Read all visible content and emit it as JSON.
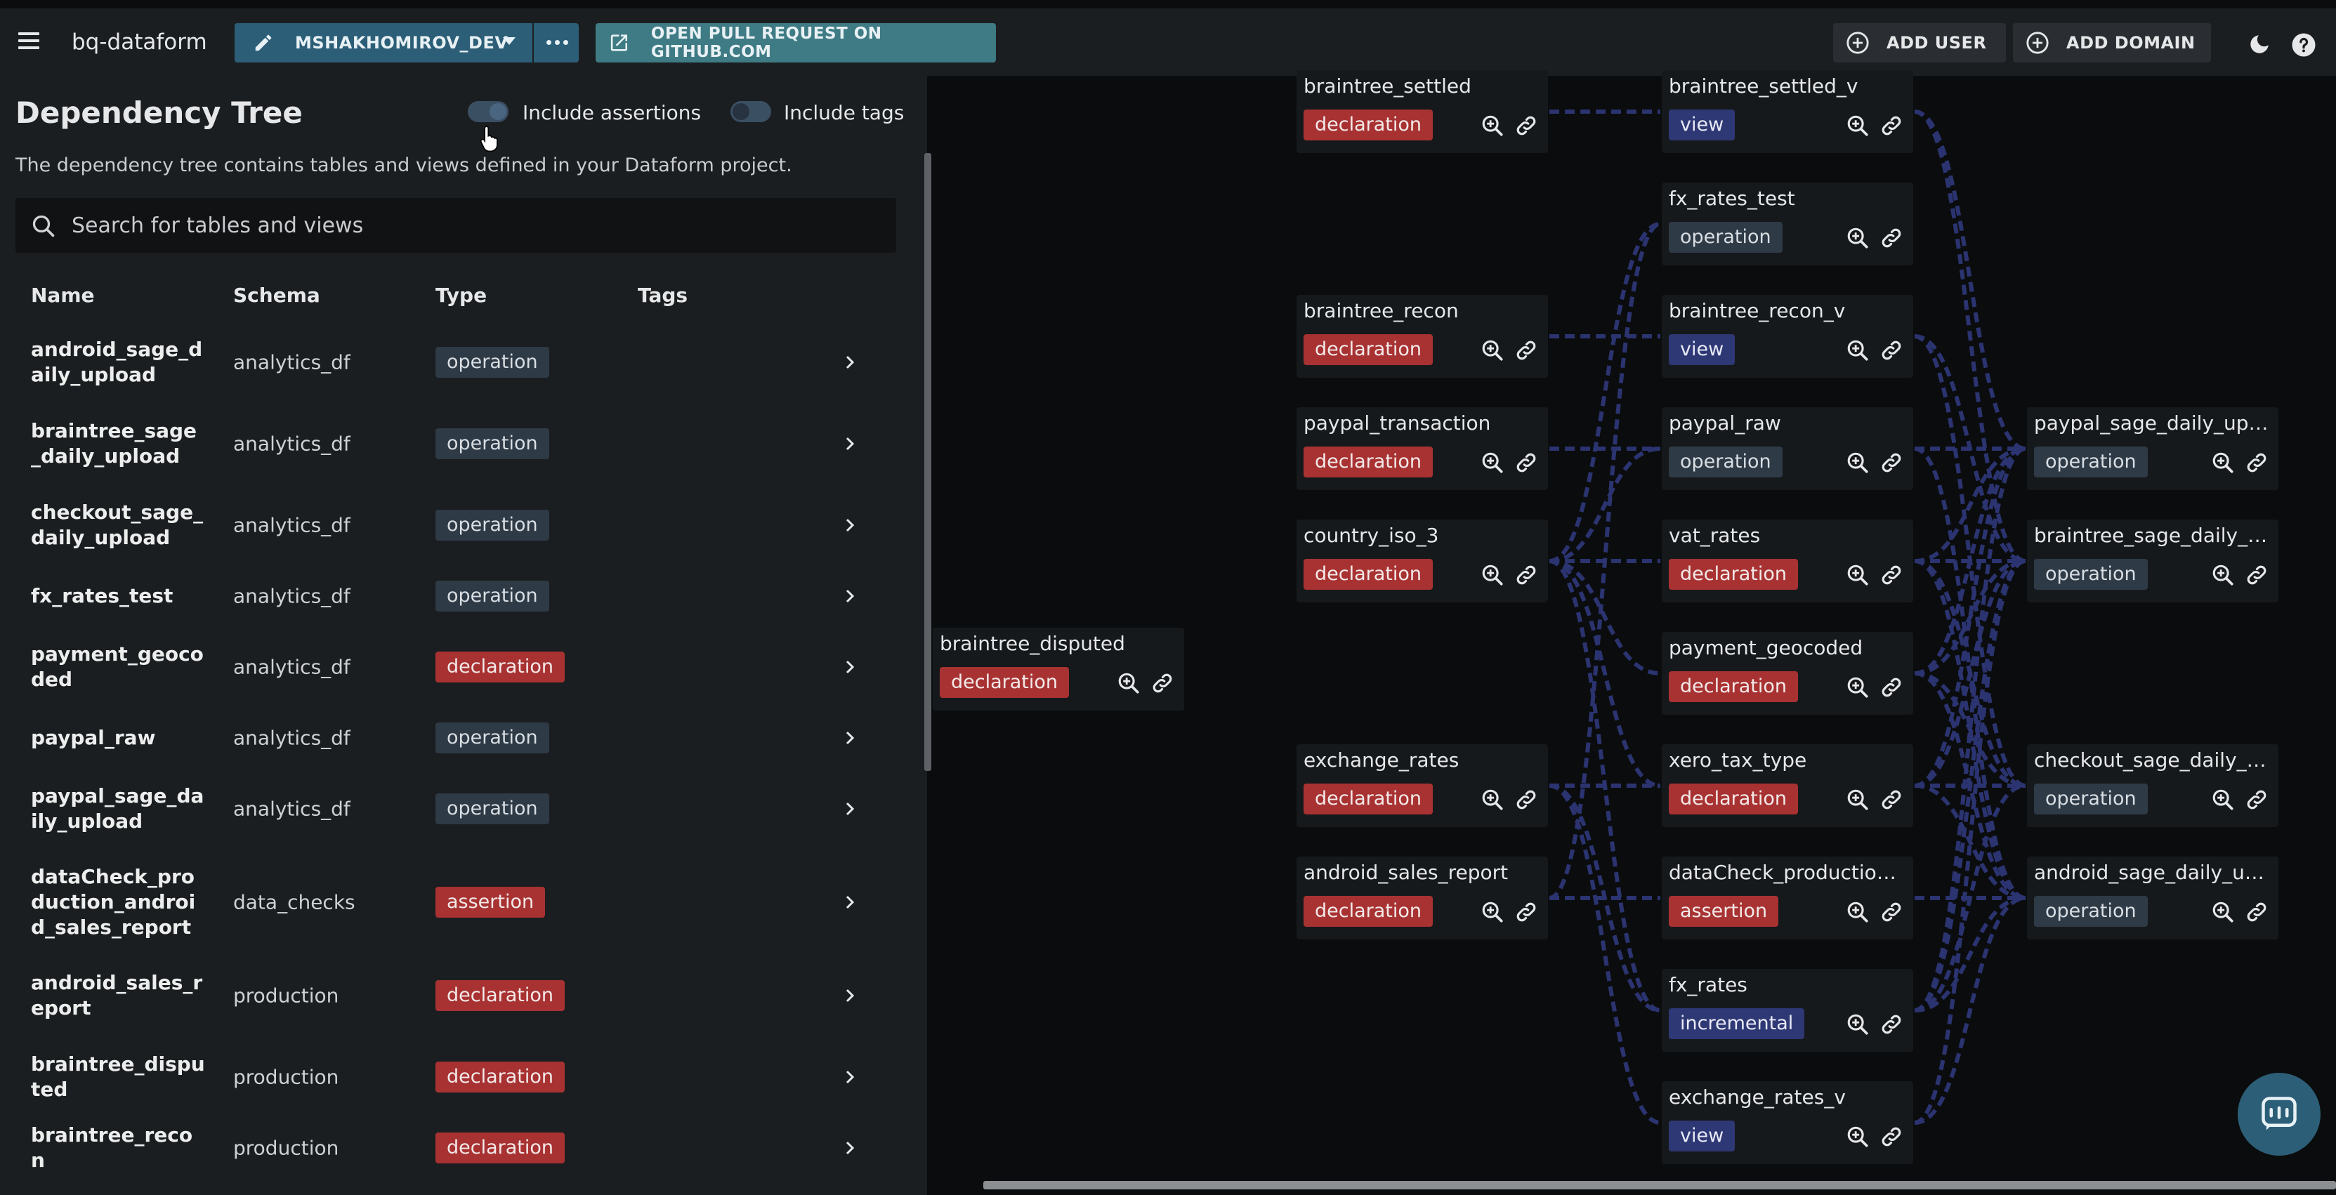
{
  "app": {
    "title": "bq-dataform"
  },
  "header": {
    "branch_label": "MSHAKHOMIROV_DEV",
    "pr_label": "OPEN PULL REQUEST ON GITHUB.COM",
    "add_user_label": "ADD USER",
    "add_domain_label": "ADD DOMAIN"
  },
  "panel": {
    "title": "Dependency Tree",
    "include_assertions_label": "Include assertions",
    "include_tags_label": "Include tags",
    "description": "The dependency tree contains tables and views defined in your Dataform project.",
    "search_placeholder": "Search for tables and views",
    "columns": {
      "name": "Name",
      "schema": "Schema",
      "type": "Type",
      "tags": "Tags"
    }
  },
  "rows": [
    {
      "name": "android_sage_daily_upload",
      "schema": "analytics_df",
      "type": "operation"
    },
    {
      "name": "braintree_sage_daily_upload",
      "schema": "analytics_df",
      "type": "operation"
    },
    {
      "name": "checkout_sage_daily_upload",
      "schema": "analytics_df",
      "type": "operation"
    },
    {
      "name": "fx_rates_test",
      "schema": "analytics_df",
      "type": "operation"
    },
    {
      "name": "payment_geocoded",
      "schema": "analytics_df",
      "type": "declaration"
    },
    {
      "name": "paypal_raw",
      "schema": "analytics_df",
      "type": "operation"
    },
    {
      "name": "paypal_sage_daily_upload",
      "schema": "analytics_df",
      "type": "operation"
    },
    {
      "name": "dataCheck_production_android_sales_report",
      "schema": "data_checks",
      "type": "assertion"
    },
    {
      "name": "android_sales_report",
      "schema": "production",
      "type": "declaration"
    },
    {
      "name": "braintree_disputed",
      "schema": "production",
      "type": "declaration"
    },
    {
      "name": "braintree_recon",
      "schema": "production",
      "type": "declaration"
    }
  ],
  "graph": {
    "nodes": [
      {
        "id": "braintree_disputed",
        "title": "braintree_disputed",
        "type": "declaration"
      },
      {
        "id": "braintree_settled",
        "title": "braintree_settled",
        "type": "declaration"
      },
      {
        "id": "braintree_recon",
        "title": "braintree_recon",
        "type": "declaration"
      },
      {
        "id": "paypal_transaction",
        "title": "paypal_transaction",
        "type": "declaration"
      },
      {
        "id": "country_iso_3",
        "title": "country_iso_3",
        "type": "declaration"
      },
      {
        "id": "exchange_rates",
        "title": "exchange_rates",
        "type": "declaration"
      },
      {
        "id": "android_sales_report",
        "title": "android_sales_report",
        "type": "declaration"
      },
      {
        "id": "braintree_settled_v",
        "title": "braintree_settled_v",
        "type": "view"
      },
      {
        "id": "fx_rates_test",
        "title": "fx_rates_test",
        "type": "operation"
      },
      {
        "id": "braintree_recon_v",
        "title": "braintree_recon_v",
        "type": "view"
      },
      {
        "id": "paypal_raw",
        "title": "paypal_raw",
        "type": "operation"
      },
      {
        "id": "vat_rates",
        "title": "vat_rates",
        "type": "declaration"
      },
      {
        "id": "payment_geocoded",
        "title": "payment_geocoded",
        "type": "declaration"
      },
      {
        "id": "xero_tax_type",
        "title": "xero_tax_type",
        "type": "declaration"
      },
      {
        "id": "dataCheck_production",
        "title": "dataCheck_production_...",
        "type": "assertion"
      },
      {
        "id": "fx_rates",
        "title": "fx_rates",
        "type": "incremental"
      },
      {
        "id": "exchange_rates_v",
        "title": "exchange_rates_v",
        "type": "view"
      },
      {
        "id": "paypal_sage_daily_upload",
        "title": "paypal_sage_daily_uplo...",
        "type": "operation"
      },
      {
        "id": "braintree_sage_daily_upload",
        "title": "braintree_sage_daily_u...",
        "type": "operation"
      },
      {
        "id": "checkout_sage_daily_upload",
        "title": "checkout_sage_daily_up...",
        "type": "operation"
      },
      {
        "id": "android_sage_daily_upload",
        "title": "android_sage_daily_upl...",
        "type": "operation"
      }
    ],
    "edges": [
      [
        "braintree_settled",
        "braintree_settled_v"
      ],
      [
        "braintree_recon",
        "braintree_recon_v"
      ],
      [
        "paypal_transaction",
        "paypal_raw"
      ],
      [
        "country_iso_3",
        "fx_rates_test"
      ],
      [
        "country_iso_3",
        "paypal_raw"
      ],
      [
        "country_iso_3",
        "vat_rates"
      ],
      [
        "country_iso_3",
        "payment_geocoded"
      ],
      [
        "country_iso_3",
        "xero_tax_type"
      ],
      [
        "country_iso_3",
        "fx_rates"
      ],
      [
        "exchange_rates",
        "exchange_rates_v"
      ],
      [
        "exchange_rates",
        "fx_rates"
      ],
      [
        "exchange_rates",
        "xero_tax_type"
      ],
      [
        "android_sales_report",
        "dataCheck_production"
      ],
      [
        "android_sales_report",
        "fx_rates_test"
      ],
      [
        "braintree_settled_v",
        "paypal_sage_daily_upload"
      ],
      [
        "braintree_settled_v",
        "braintree_sage_daily_upload"
      ],
      [
        "braintree_recon_v",
        "braintree_sage_daily_upload"
      ],
      [
        "braintree_recon_v",
        "checkout_sage_daily_upload"
      ],
      [
        "paypal_raw",
        "paypal_sage_daily_upload"
      ],
      [
        "paypal_raw",
        "android_sage_daily_upload"
      ],
      [
        "vat_rates",
        "paypal_sage_daily_upload"
      ],
      [
        "vat_rates",
        "braintree_sage_daily_upload"
      ],
      [
        "vat_rates",
        "checkout_sage_daily_upload"
      ],
      [
        "vat_rates",
        "android_sage_daily_upload"
      ],
      [
        "payment_geocoded",
        "paypal_sage_daily_upload"
      ],
      [
        "payment_geocoded",
        "braintree_sage_daily_upload"
      ],
      [
        "payment_geocoded",
        "checkout_sage_daily_upload"
      ],
      [
        "payment_geocoded",
        "android_sage_daily_upload"
      ],
      [
        "xero_tax_type",
        "paypal_sage_daily_upload"
      ],
      [
        "xero_tax_type",
        "braintree_sage_daily_upload"
      ],
      [
        "xero_tax_type",
        "checkout_sage_daily_upload"
      ],
      [
        "xero_tax_type",
        "android_sage_daily_upload"
      ],
      [
        "dataCheck_production",
        "android_sage_daily_upload"
      ],
      [
        "fx_rates",
        "paypal_sage_daily_upload"
      ],
      [
        "fx_rates",
        "braintree_sage_daily_upload"
      ],
      [
        "fx_rates",
        "checkout_sage_daily_upload"
      ],
      [
        "fx_rates",
        "android_sage_daily_upload"
      ],
      [
        "exchange_rates_v",
        "braintree_sage_daily_upload"
      ],
      [
        "exchange_rates_v",
        "android_sage_daily_upload"
      ]
    ]
  },
  "colors": {
    "declaration": "#a83232",
    "operation": "#2e3a46",
    "view": "#2e3874",
    "incremental": "#2e3874",
    "assertion": "#a83232",
    "edge": "#2b3470"
  }
}
